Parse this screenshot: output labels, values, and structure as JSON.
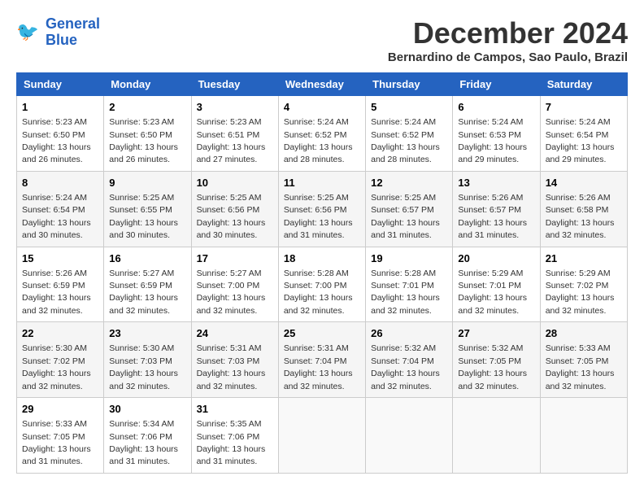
{
  "header": {
    "logo_line1": "General",
    "logo_line2": "Blue",
    "month_title": "December 2024",
    "location": "Bernardino de Campos, Sao Paulo, Brazil"
  },
  "weekdays": [
    "Sunday",
    "Monday",
    "Tuesday",
    "Wednesday",
    "Thursday",
    "Friday",
    "Saturday"
  ],
  "weeks": [
    [
      {
        "day": "1",
        "sunrise": "5:23 AM",
        "sunset": "6:50 PM",
        "daylight": "13 hours and 26 minutes."
      },
      {
        "day": "2",
        "sunrise": "5:23 AM",
        "sunset": "6:50 PM",
        "daylight": "13 hours and 26 minutes."
      },
      {
        "day": "3",
        "sunrise": "5:23 AM",
        "sunset": "6:51 PM",
        "daylight": "13 hours and 27 minutes."
      },
      {
        "day": "4",
        "sunrise": "5:24 AM",
        "sunset": "6:52 PM",
        "daylight": "13 hours and 28 minutes."
      },
      {
        "day": "5",
        "sunrise": "5:24 AM",
        "sunset": "6:52 PM",
        "daylight": "13 hours and 28 minutes."
      },
      {
        "day": "6",
        "sunrise": "5:24 AM",
        "sunset": "6:53 PM",
        "daylight": "13 hours and 29 minutes."
      },
      {
        "day": "7",
        "sunrise": "5:24 AM",
        "sunset": "6:54 PM",
        "daylight": "13 hours and 29 minutes."
      }
    ],
    [
      {
        "day": "8",
        "sunrise": "5:24 AM",
        "sunset": "6:54 PM",
        "daylight": "13 hours and 30 minutes."
      },
      {
        "day": "9",
        "sunrise": "5:25 AM",
        "sunset": "6:55 PM",
        "daylight": "13 hours and 30 minutes."
      },
      {
        "day": "10",
        "sunrise": "5:25 AM",
        "sunset": "6:56 PM",
        "daylight": "13 hours and 30 minutes."
      },
      {
        "day": "11",
        "sunrise": "5:25 AM",
        "sunset": "6:56 PM",
        "daylight": "13 hours and 31 minutes."
      },
      {
        "day": "12",
        "sunrise": "5:25 AM",
        "sunset": "6:57 PM",
        "daylight": "13 hours and 31 minutes."
      },
      {
        "day": "13",
        "sunrise": "5:26 AM",
        "sunset": "6:57 PM",
        "daylight": "13 hours and 31 minutes."
      },
      {
        "day": "14",
        "sunrise": "5:26 AM",
        "sunset": "6:58 PM",
        "daylight": "13 hours and 32 minutes."
      }
    ],
    [
      {
        "day": "15",
        "sunrise": "5:26 AM",
        "sunset": "6:59 PM",
        "daylight": "13 hours and 32 minutes."
      },
      {
        "day": "16",
        "sunrise": "5:27 AM",
        "sunset": "6:59 PM",
        "daylight": "13 hours and 32 minutes."
      },
      {
        "day": "17",
        "sunrise": "5:27 AM",
        "sunset": "7:00 PM",
        "daylight": "13 hours and 32 minutes."
      },
      {
        "day": "18",
        "sunrise": "5:28 AM",
        "sunset": "7:00 PM",
        "daylight": "13 hours and 32 minutes."
      },
      {
        "day": "19",
        "sunrise": "5:28 AM",
        "sunset": "7:01 PM",
        "daylight": "13 hours and 32 minutes."
      },
      {
        "day": "20",
        "sunrise": "5:29 AM",
        "sunset": "7:01 PM",
        "daylight": "13 hours and 32 minutes."
      },
      {
        "day": "21",
        "sunrise": "5:29 AM",
        "sunset": "7:02 PM",
        "daylight": "13 hours and 32 minutes."
      }
    ],
    [
      {
        "day": "22",
        "sunrise": "5:30 AM",
        "sunset": "7:02 PM",
        "daylight": "13 hours and 32 minutes."
      },
      {
        "day": "23",
        "sunrise": "5:30 AM",
        "sunset": "7:03 PM",
        "daylight": "13 hours and 32 minutes."
      },
      {
        "day": "24",
        "sunrise": "5:31 AM",
        "sunset": "7:03 PM",
        "daylight": "13 hours and 32 minutes."
      },
      {
        "day": "25",
        "sunrise": "5:31 AM",
        "sunset": "7:04 PM",
        "daylight": "13 hours and 32 minutes."
      },
      {
        "day": "26",
        "sunrise": "5:32 AM",
        "sunset": "7:04 PM",
        "daylight": "13 hours and 32 minutes."
      },
      {
        "day": "27",
        "sunrise": "5:32 AM",
        "sunset": "7:05 PM",
        "daylight": "13 hours and 32 minutes."
      },
      {
        "day": "28",
        "sunrise": "5:33 AM",
        "sunset": "7:05 PM",
        "daylight": "13 hours and 32 minutes."
      }
    ],
    [
      {
        "day": "29",
        "sunrise": "5:33 AM",
        "sunset": "7:05 PM",
        "daylight": "13 hours and 31 minutes."
      },
      {
        "day": "30",
        "sunrise": "5:34 AM",
        "sunset": "7:06 PM",
        "daylight": "13 hours and 31 minutes."
      },
      {
        "day": "31",
        "sunrise": "5:35 AM",
        "sunset": "7:06 PM",
        "daylight": "13 hours and 31 minutes."
      },
      null,
      null,
      null,
      null
    ]
  ],
  "labels": {
    "sunrise_prefix": "Sunrise: ",
    "sunset_prefix": "Sunset: ",
    "daylight_prefix": "Daylight: "
  }
}
